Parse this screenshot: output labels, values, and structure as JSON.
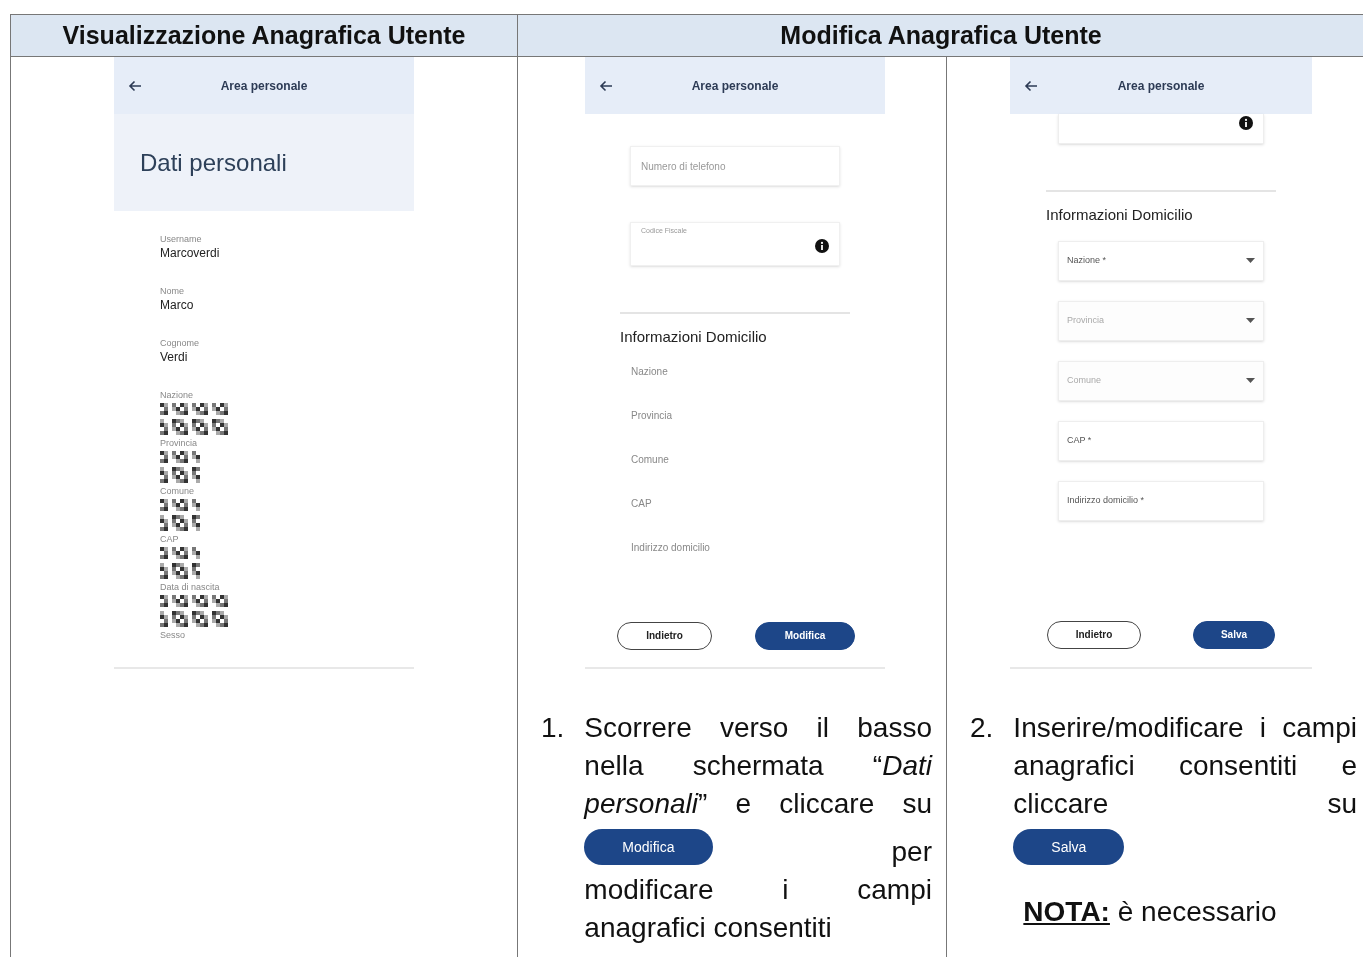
{
  "table": {
    "headers": [
      {
        "text": "Visualizzazione Anagrafica Utente"
      },
      {
        "text": "Modifica Anagrafica Utente"
      }
    ]
  },
  "view_screen": {
    "app_bar_title": "Area personale",
    "page_title": "Dati personali",
    "fields": [
      {
        "label": "Username",
        "value": "Marcoverdi",
        "kind": "text"
      },
      {
        "label": "Nome",
        "value": "Marco",
        "kind": "text"
      },
      {
        "label": "Cognome",
        "value": "Verdi",
        "kind": "text"
      },
      {
        "label": "Nazione",
        "kind": "redacted_long"
      },
      {
        "label": "Provincia",
        "kind": "redacted_short"
      },
      {
        "label": "Comune",
        "kind": "redacted_short"
      },
      {
        "label": "CAP",
        "kind": "redacted_short"
      },
      {
        "label": "Data di nascita",
        "kind": "redacted_long"
      },
      {
        "label": "Sesso",
        "kind": "label_only"
      }
    ]
  },
  "edit_screen_1": {
    "app_bar_title": "Area personale",
    "fields": [
      {
        "kind": "input",
        "placeholder": "Numero di telefono"
      },
      {
        "kind": "input_info",
        "label": "Codice Fiscale"
      }
    ],
    "section_title": "Informazioni Domicilio",
    "address_labels": [
      "Nazione",
      "Provincia",
      "Comune",
      "CAP",
      "Indirizzo domicilio"
    ],
    "buttons": [
      {
        "label": "Indietro",
        "kind": "outline"
      },
      {
        "label": "Modifica",
        "kind": "primary"
      }
    ]
  },
  "edit_screen_2": {
    "app_bar_title": "Area personale",
    "fields": [
      {
        "kind": "input_info_cut"
      }
    ],
    "section_title": "Informazioni Domicilio",
    "address_fields": [
      {
        "label": "Nazione *",
        "kind": "select",
        "disabled": false
      },
      {
        "label": "Provincia",
        "kind": "select",
        "disabled": true
      },
      {
        "label": "Comune",
        "kind": "select",
        "disabled": true
      },
      {
        "label": "CAP *",
        "kind": "input",
        "disabled": false
      },
      {
        "label": "Indirizzo domicilio *",
        "kind": "input",
        "disabled": false
      }
    ],
    "buttons": [
      {
        "label": "Indietro",
        "kind": "outline"
      },
      {
        "label": "Salva",
        "kind": "primary"
      }
    ]
  },
  "steps": [
    {
      "number": "1.",
      "text_before": "Scorrere verso il basso nella schermata “*Dati personali*” e cliccare su",
      "button": "Modifica",
      "text_after_inline": "per",
      "text_after": "modificare i campi anagrafici consentiti"
    },
    {
      "number": "2.",
      "text_before": "Inserire/modificare i campi anagrafici consentiti e cliccare su",
      "button": "Salva",
      "note_label": "NOTA:",
      "note_text": "è necessario"
    }
  ]
}
